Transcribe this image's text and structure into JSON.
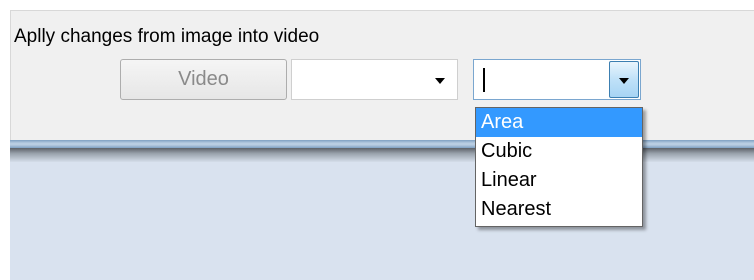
{
  "panel": {
    "title": "Aplly changes from image into video"
  },
  "buttons": {
    "video_label": "Video"
  },
  "combo_first": {
    "value": ""
  },
  "combo_interpolation": {
    "value": "",
    "options": [
      "Area",
      "Cubic",
      "Linear",
      "Nearest"
    ],
    "highlighted": "Area"
  },
  "colors": {
    "highlight": "#3399ff",
    "panel_background": "#f0f0f0",
    "content_background": "#d9e2ef"
  },
  "icons": {
    "dropdown_arrow": "chevron-down-icon"
  }
}
